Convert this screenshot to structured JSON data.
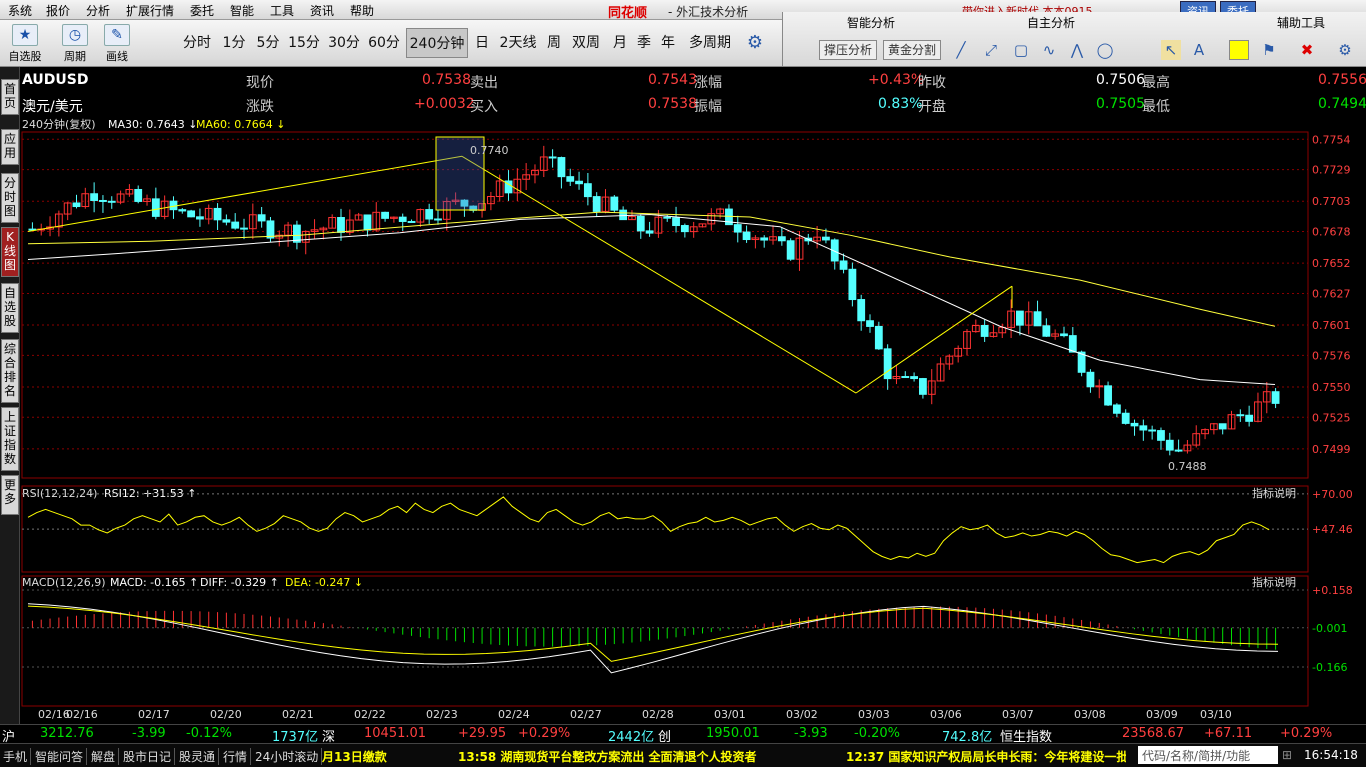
{
  "menu": {
    "items": [
      "系统",
      "报价",
      "分析",
      "扩展行情",
      "委托",
      "智能",
      "工具",
      "资讯",
      "帮助"
    ],
    "brand": "同花顺",
    "title": "- 外汇技术分析",
    "right_text": "带你进入新时代   本本0915",
    "news_btn": "资讯",
    "trade_btn": "委托"
  },
  "toolbar": {
    "buttons": [
      {
        "label": "自选股",
        "icon": "★"
      },
      {
        "label": "周期",
        "icon": "◷"
      },
      {
        "label": "画线",
        "icon": "✎"
      }
    ],
    "periods": [
      "分时",
      "1分",
      "5分",
      "15分",
      "30分",
      "60分",
      "240分钟",
      "日",
      "2天线",
      "周",
      "双周",
      "月",
      "季",
      "年",
      "多周期"
    ],
    "active_period": "240分钟",
    "gear": "⚙"
  },
  "panels": {
    "smart": {
      "title": "智能分析",
      "btn1": "撑压分析",
      "btn2": "黄金分割"
    },
    "self": {
      "title": "自主分析"
    },
    "aux": {
      "title": "辅助工具"
    }
  },
  "sidetabs": [
    "首页",
    "应用",
    "分时图",
    "K线图",
    "自选股",
    "综合排名",
    "上证指数",
    "更多"
  ],
  "quote": {
    "code": "AUDUSD",
    "name": "澳元/美元",
    "l_price": "现价",
    "price": "0.7538",
    "l_sell": "卖出",
    "sell": "0.7543",
    "l_chg_pct": "涨幅",
    "chg_pct": "+0.43%",
    "l_prev": "昨收",
    "prev": "0.7506",
    "l_high": "最高",
    "high": "0.7556",
    "l_chg": "涨跌",
    "chg": "+0.0032",
    "l_buy": "买入",
    "buy": "0.7538",
    "l_amp": "振幅",
    "amp": "0.83%",
    "l_open": "开盘",
    "open": "0.7505",
    "l_low": "最低",
    "low": "0.7494",
    "period_label": "240分钟(复权)",
    "ma30": "MA30: 0.7643",
    "ma60": "MA60: 0.7664"
  },
  "indicators": {
    "rsi_label": "RSI(12,12,24)",
    "rsi_val": "RSI12: +31.53",
    "macd_label": "MACD(12,26,9)",
    "macd_val": "MACD: -0.165",
    "diff": "DIFF: -0.329",
    "dea": "DEA: -0.247",
    "help": "指标说明"
  },
  "chart_data": {
    "type": "candlestick",
    "price_ticks": [
      0.7754,
      0.7729,
      0.7703,
      0.7678,
      0.7652,
      0.7627,
      0.7601,
      0.7576,
      0.755,
      0.7525,
      0.7499
    ],
    "price_labels": [
      "0.7754",
      "0.7729",
      "0.7703",
      "0.7678",
      "0.7652",
      "0.7627",
      "0.7601",
      "0.7576",
      "0.7550",
      "0.7525",
      "0.7499"
    ],
    "ylim": [
      0.7475,
      0.776
    ],
    "annot_high": "0.7740",
    "annot_low": "0.7488",
    "dates": [
      "02/16",
      "02/16",
      "02/17",
      "02/20",
      "02/21",
      "02/22",
      "02/23",
      "02/24",
      "02/27",
      "02/28",
      "03/01",
      "03/02",
      "03/03",
      "03/06",
      "03/07",
      "03/08",
      "03/09",
      "03/10"
    ],
    "rsi_ticks": [
      "+70.00",
      "+47.46"
    ],
    "macd_ticks": [
      "+0.158",
      "-0.001",
      "-0.166"
    ],
    "rsi_values": [
      55,
      58,
      60,
      58,
      56,
      54,
      50,
      50,
      47,
      45,
      48,
      50,
      54,
      56,
      54,
      52,
      57,
      50,
      52,
      55,
      56,
      52,
      50,
      52,
      55,
      50,
      46,
      48,
      51,
      56,
      54,
      52,
      48,
      46,
      48,
      54,
      58,
      56,
      52,
      54,
      56,
      60,
      62,
      58,
      64,
      60,
      58,
      62,
      64,
      60,
      58,
      56,
      60,
      64,
      68,
      62,
      58,
      54,
      52,
      58,
      60,
      56,
      52,
      50,
      52,
      56,
      58,
      54,
      55,
      54,
      54,
      56,
      52,
      46,
      49,
      51,
      52,
      55,
      52,
      53,
      55,
      53,
      50,
      52,
      54,
      55,
      50,
      46,
      49,
      51,
      48,
      47,
      50,
      48,
      43,
      38,
      33,
      30,
      28,
      30,
      29,
      32,
      30,
      32,
      40,
      45,
      49,
      47,
      48,
      50,
      45,
      42,
      43,
      45,
      43,
      44,
      46,
      45,
      43,
      46,
      44,
      40,
      35,
      31,
      30,
      28,
      26,
      27,
      28,
      26,
      30,
      32,
      33,
      31,
      34,
      40,
      42,
      44,
      50,
      52,
      50,
      47
    ]
  },
  "status": {
    "sh": "沪",
    "sh_val": "3212.76",
    "sh_chg": "-3.99",
    "sh_pct": "-0.12%",
    "sh_amt": "1737亿",
    "sz": "深",
    "sz_val": "10451.01",
    "sz_chg": "+29.95",
    "sz_pct": "+0.29%",
    "sz_amt": "2442亿",
    "cy": "创",
    "cy_val": "1950.01",
    "cy_chg": "-3.93",
    "cy_pct": "-0.20%",
    "cy_amt": "742.8亿",
    "hs": "恒生指数",
    "hs_val": "23568.67",
    "hs_chg": "+67.11",
    "hs_pct": "+0.29%"
  },
  "ticker": {
    "b1": "手机",
    "b2": "智能问答",
    "b3": "解盘",
    "b4": "股市日记",
    "b5": "股灵通",
    "b6": "行情",
    "b7": "24小时滚动",
    "n1": "月13日缴款",
    "n2": "13:58 湖南现货平台整改方案流出 全面清退个人投资者",
    "n3": "12:37 国家知识产权局局长申长雨：今年将建设一批",
    "search": "代码/名称/简拼/功能",
    "time": "16:54:18"
  },
  "colors": {
    "up": "#ff3232",
    "down": "#54ffff",
    "ma30": "#ffffff",
    "ma60": "#ffff3c",
    "grid": "#8b0000",
    "text_up": "#ff4040",
    "text_down": "#00e000",
    "yellow": "#ffff00"
  }
}
